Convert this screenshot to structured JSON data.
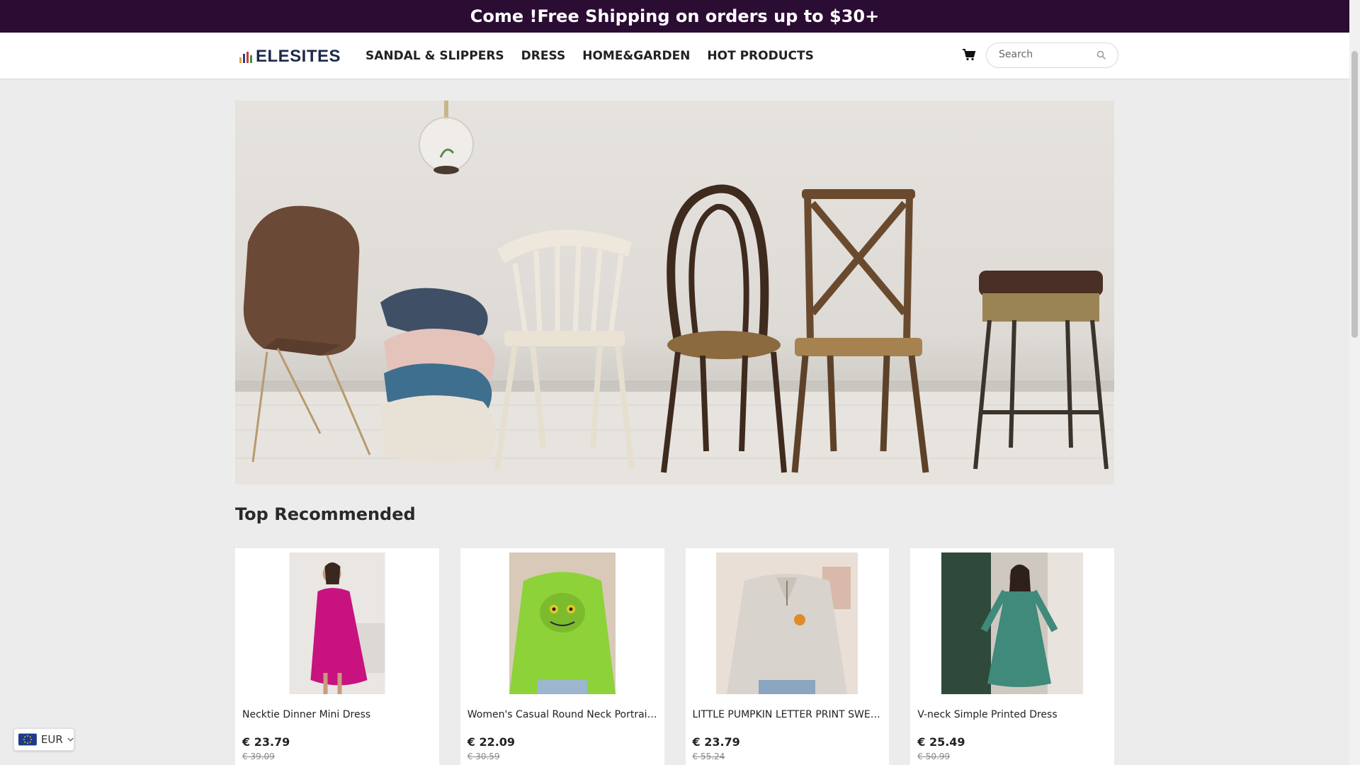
{
  "announcement": "Come !Free Shipping on orders up to $30+",
  "header": {
    "logo_text": "ELESITES",
    "nav": [
      "SANDAL & SLIPPERS",
      "DRESS",
      "HOME&GARDEN",
      "HOT PRODUCTS"
    ],
    "search_placeholder": "Search",
    "icons": {
      "cart": "cart-icon",
      "search": "search-icon"
    }
  },
  "section": {
    "title": "Top Recommended"
  },
  "products": [
    {
      "name": "Necktie Dinner Mini Dress",
      "price": "€ 23.79",
      "old_price": "€ 39.09"
    },
    {
      "name": "Women's Casual Round Neck Portrait Pri...",
      "price": "€ 22.09",
      "old_price": "€ 30.59"
    },
    {
      "name": "LITTLE PUMPKIN LETTER PRINT SWEATS...",
      "price": "€ 23.79",
      "old_price": "€ 55.24"
    },
    {
      "name": "V-neck Simple Printed Dress",
      "price": "€ 25.49",
      "old_price": "€ 50.99"
    }
  ],
  "currency": {
    "code": "EUR"
  },
  "colors": {
    "announcement_bg": "#2b0c33",
    "page_bg": "#ececec"
  }
}
